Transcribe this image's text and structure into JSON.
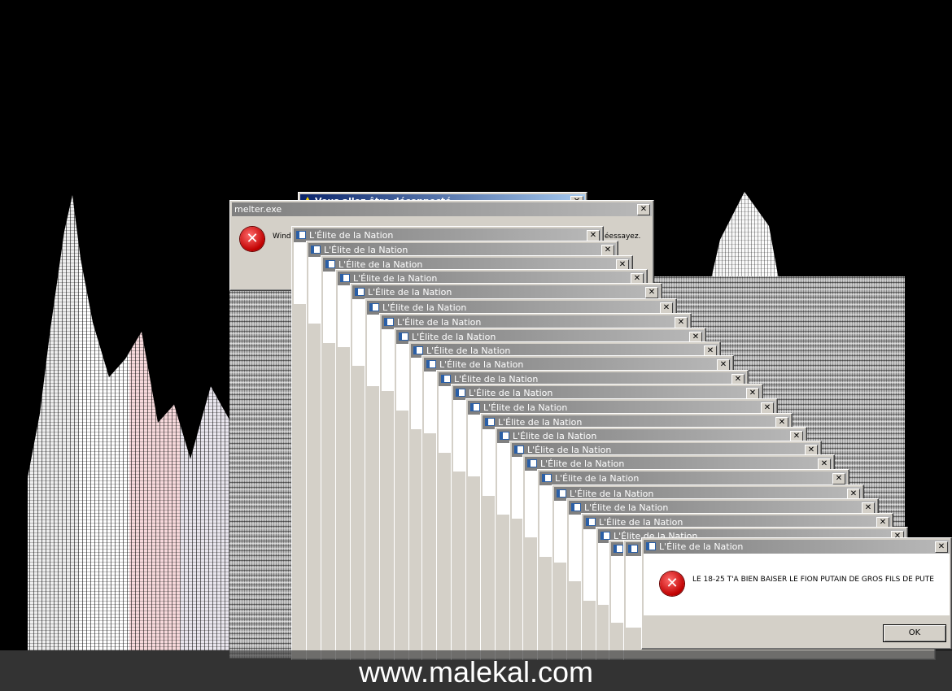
{
  "back_dialog": {
    "title": "Vous allez être déconnecté"
  },
  "melter_dialog": {
    "title": "melter.exe",
    "message_start": "Wind",
    "message_end": "éessayez."
  },
  "cascade": {
    "window_title": "L'Élite de la Nation",
    "close_glyph": "✕"
  },
  "front_dialog": {
    "title": "L'Élite de la Nation",
    "message": "LE 18-25 T'A BIEN BAISER LE FION PUTAIN DE GROS FILS DE PUTE",
    "ok_label": "OK"
  },
  "watermark": "www.malekal.com",
  "colors": {
    "title_inactive": "#7f7f7f",
    "title_active": "#0a246a",
    "face": "#d4d0c8",
    "error_red": "#c00000"
  }
}
